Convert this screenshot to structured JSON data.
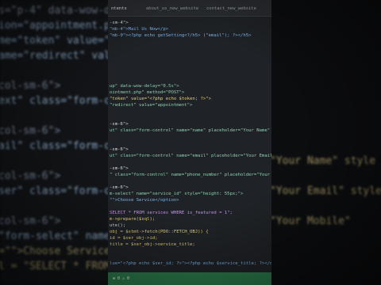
{
  "tabs": [
    {
      "label": "ntents"
    },
    {
      "label": "about_us_new_website"
    },
    {
      "label": "contact_new_website"
    }
  ],
  "code": [
    "-sm-4\">",
    "\"mb-4\">Mail Us Now</p>",
    "\"mb-0\"><?php echo getSetting<?/h5> (\"email\"); ?></h5>",
    "",
    "",
    "",
    "",
    "",
    "",
    "",
    "up\" data-wow-delay=\"0.5s\">",
    "ointment.php\" method=\"POST\">",
    "\"token\" value=\"<?php echo $token; ?>\">",
    "\"redirect\" value=\"appointment\">",
    "",
    "",
    "-sm-6\">",
    "ut\" class=\"form-control\" name=\"name\" placeholder=\"Your Name\" style",
    "",
    "",
    "-sm-6\">",
    "ut\" class=\"form-control\" name=\"email\" placeholder=\"Your Email\" style",
    "",
    "-sm-6\">",
    "\" class=\"form-control\" name=\"phone_number\" placeholder=\"Your Mobile",
    "",
    "-sm-6\">",
    "m-select\" name=\"service_id\" style=\"height: 55px;\">",
    "\"\">Choose Service</option>",
    "",
    "SELECT * FROM services WHERE is_featured = 1\";",
    "m->prepare($sql);",
    "ute();",
    "obj = $stmt->fetch(PDO::FETCH_OBJ)) {",
    "id = $ser_obj->id;",
    "title = $ser_obj->service_title;",
    "",
    "",
    "lue=\"<?php echo $ser_id; ?>\"><?php echo $service_title; ?></option>"
  ],
  "status": {
    "text": "⊗ 0 ⚠ 0"
  },
  "background_left": [
    "s=\"p-4\" data-wow-delay=\"0",
    "ion=\"appointment.php\" method=\"POST",
    "me=\"token\" value=\"<",
    "ame=\"redirect\" value=\"",
    "",
    "col-sm-6\">",
    "ext\" class=\"form-contro",
    "",
    "col-sm-6\">",
    "ail\" class=\"form-contro",
    "",
    "col-sm-6\">",
    "ser\" class=\"form-contro",
    "",
    "col-sm-6\">",
    "\"form-select\" name=\"servi",
    "=\"\">Choose Service</opti",
    "l = \"SELECT * FROM servic"
  ],
  "background_right": [
    "",
    "",
    "",
    "",
    "",
    "",
    "",
    "",
    "",
    "",
    "\"Your Name\" style",
    "",
    "\"Your Email\" style",
    "",
    "\"Your Mobile\"",
    ""
  ],
  "colors": {
    "screen_bg": "#1f2226",
    "statusbar": "#2b7a4b",
    "tag": "#7cb4e8",
    "string": "#e3cf7e"
  }
}
